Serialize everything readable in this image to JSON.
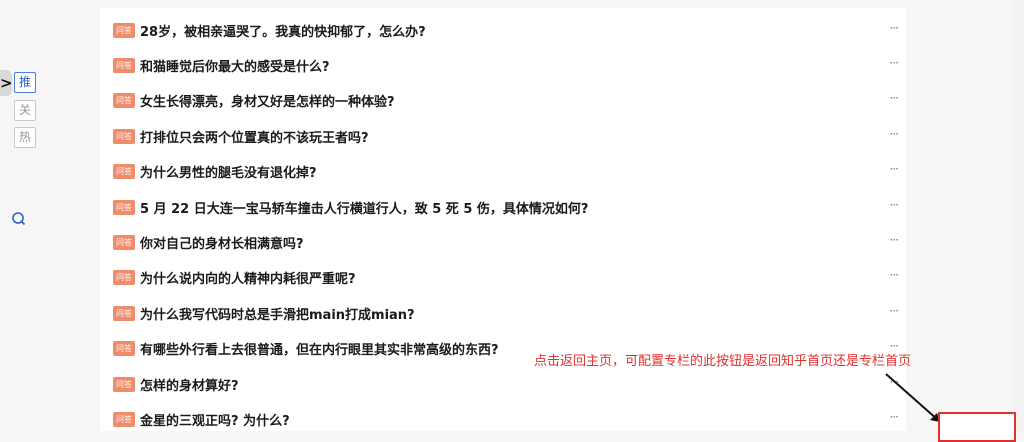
{
  "left_nav": {
    "collapse_glyph": ">",
    "tabs": [
      {
        "label": "推",
        "active": true
      },
      {
        "label": "关",
        "active": false
      },
      {
        "label": "热",
        "active": false
      }
    ],
    "search_icon": "search-icon"
  },
  "feed": {
    "badge_label": "问答",
    "more_label": "···",
    "items": [
      {
        "title": "28岁，被相亲逼哭了。我真的快抑郁了，怎么办?"
      },
      {
        "title": "和猫睡觉后你最大的感受是什么?"
      },
      {
        "title": "女生长得漂亮，身材又好是怎样的一种体验?"
      },
      {
        "title": "打排位只会两个位置真的不该玩王者吗?"
      },
      {
        "title": "为什么男性的腿毛没有退化掉?"
      },
      {
        "title": "5 月 22 日大连一宝马轿车撞击人行横道行人，致 5 死 5 伤，具体情况如何?"
      },
      {
        "title": "你对自己的身材长相满意吗?"
      },
      {
        "title": "为什么说内向的人精神内耗很严重呢?"
      },
      {
        "title": "为什么我写代码时总是手滑把main打成mian?"
      },
      {
        "title": "有哪些外行看上去很普通，但在内行眼里其实非常高级的东西?"
      },
      {
        "title": "怎样的身材算好?"
      },
      {
        "title": "金星的三观正吗? 为什么?"
      }
    ]
  },
  "annotation": {
    "text": "点击返回主页，可配置专栏的此按钮是返回知乎首页还是专栏首页",
    "color": "#e1302f"
  }
}
